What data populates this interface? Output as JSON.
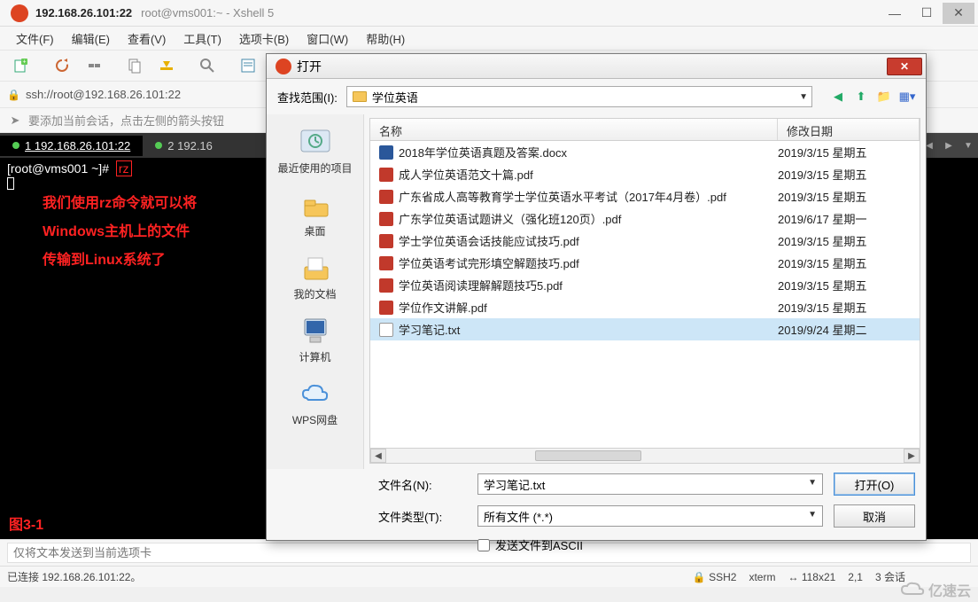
{
  "titlebar": {
    "main": "192.168.26.101:22",
    "sub": "root@vms001:~ - Xshell 5"
  },
  "menu": [
    "文件(F)",
    "编辑(E)",
    "查看(V)",
    "工具(T)",
    "选项卡(B)",
    "窗口(W)",
    "帮助(H)"
  ],
  "addressbar": {
    "url": "ssh://root@192.168.26.101:22"
  },
  "hint": "要添加当前会话，点击左侧的箭头按钮",
  "tabs": [
    {
      "label": "1 192.168.26.101:22",
      "active": true
    },
    {
      "label": "2 192.16",
      "active": false
    }
  ],
  "terminal": {
    "prompt": "[root@vms001 ~]#",
    "cmd": "rz",
    "note1": "我们使用rz命令就可以将",
    "note2": "Windows主机上的文件",
    "note3": "传输到Linux系统了",
    "figlabel": "图3-1"
  },
  "footer_placeholder": "仅将文本发送到当前选项卡",
  "status": {
    "left": "已连接 192.168.26.101:22。",
    "ssh": "SSH2",
    "term": "xterm",
    "size": "118x21",
    "pos": "2,1",
    "sess": "3 会话"
  },
  "logo": "亿速云",
  "dialog": {
    "title": "打开",
    "look_label": "查找范围(I):",
    "look_value": "学位英语",
    "places": [
      "最近使用的项目",
      "桌面",
      "我的文档",
      "计算机",
      "WPS网盘"
    ],
    "cols": {
      "name": "名称",
      "date": "修改日期"
    },
    "files": [
      {
        "icon": "docx",
        "name": "2018年学位英语真题及答案.docx",
        "date": "2019/3/15 星期五"
      },
      {
        "icon": "pdf",
        "name": "成人学位英语范文十篇.pdf",
        "date": "2019/3/15 星期五"
      },
      {
        "icon": "pdf",
        "name": "广东省成人高等教育学士学位英语水平考试（2017年4月卷）.pdf",
        "date": "2019/3/15 星期五"
      },
      {
        "icon": "pdf",
        "name": "广东学位英语试题讲义（强化班120页）.pdf",
        "date": "2019/6/17 星期一"
      },
      {
        "icon": "pdf",
        "name": "学士学位英语会话技能应试技巧.pdf",
        "date": "2019/3/15 星期五"
      },
      {
        "icon": "pdf",
        "name": "学位英语考试完形填空解题技巧.pdf",
        "date": "2019/3/15 星期五"
      },
      {
        "icon": "pdf",
        "name": "学位英语阅读理解解题技巧5.pdf",
        "date": "2019/3/15 星期五"
      },
      {
        "icon": "pdf",
        "name": "学位作文讲解.pdf",
        "date": "2019/3/15 星期五"
      },
      {
        "icon": "txt",
        "name": "学习笔记.txt",
        "date": "2019/9/24 星期二",
        "selected": true
      }
    ],
    "filename_label": "文件名(N):",
    "filename_value": "学习笔记.txt",
    "filetype_label": "文件类型(T):",
    "filetype_value": "所有文件 (*.*)",
    "open_btn": "打开(O)",
    "cancel_btn": "取消",
    "ascii_chk": "发送文件到ASCII"
  }
}
